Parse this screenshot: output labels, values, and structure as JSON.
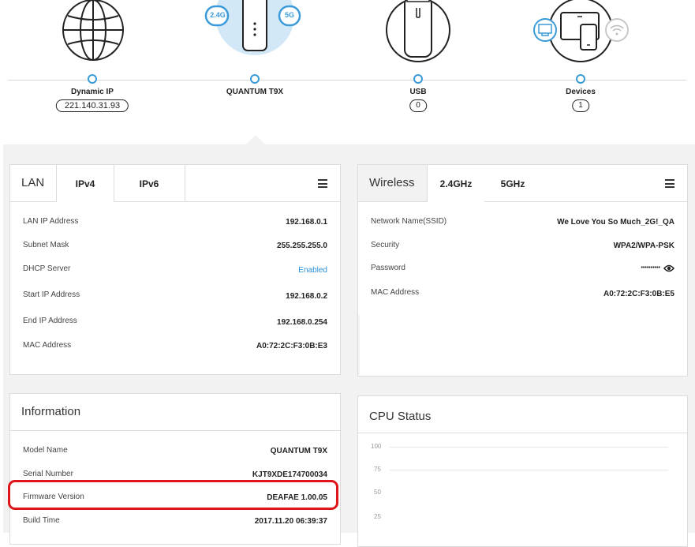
{
  "topology": {
    "internet": {
      "label": "Dynamic IP",
      "value": "221.140.31.93"
    },
    "router": {
      "label": "QUANTUM T9X",
      "band_24": "2.4G",
      "band_5": "5G"
    },
    "usb": {
      "label": "USB",
      "count": "0"
    },
    "devices": {
      "label": "Devices",
      "count": "1"
    }
  },
  "lan": {
    "title": "LAN",
    "tabs": [
      "IPv4",
      "IPv6"
    ],
    "active_tab": "IPv4",
    "rows": [
      {
        "key": "LAN IP Address",
        "value": "192.168.0.1"
      },
      {
        "key": "Subnet Mask",
        "value": "255.255.255.0"
      },
      {
        "key": "DHCP Server",
        "value": "Enabled"
      },
      {
        "key": "Start IP Address",
        "value": "192.168.0.2"
      },
      {
        "key": "End IP Address",
        "value": "192.168.0.254"
      },
      {
        "key": "MAC Address",
        "value": "A0:72:2C:F3:0B:E3"
      }
    ]
  },
  "wireless": {
    "title": "Wireless",
    "tabs": [
      "2.4GHz",
      "5GHz"
    ],
    "active_tab": "2.4GHz",
    "rows": [
      {
        "key": "Network Name(SSID)",
        "value": "We Love You So Much_2G!_QA"
      },
      {
        "key": "Security",
        "value": "WPA2/WPA-PSK"
      },
      {
        "key": "Password",
        "value": "••••••••••"
      },
      {
        "key": "MAC Address",
        "value": "A0:72:2C:F3:0B:E5"
      }
    ]
  },
  "information": {
    "title": "Information",
    "rows": [
      {
        "key": "Model Name",
        "value": "QUANTUM T9X"
      },
      {
        "key": "Serial Number",
        "value": "KJT9XDE174700034"
      },
      {
        "key": "Firmware Version",
        "value": "DEAFAE 1.00.05"
      },
      {
        "key": "Build Time",
        "value": "2017.11.20 06:39:37"
      }
    ]
  },
  "cpu": {
    "title": "CPU Status",
    "y_ticks": [
      "100",
      "75",
      "50",
      "25"
    ]
  },
  "colors": {
    "accent": "#3a9bd8",
    "link": "#2a8fd6",
    "highlight": "#e0151c"
  }
}
